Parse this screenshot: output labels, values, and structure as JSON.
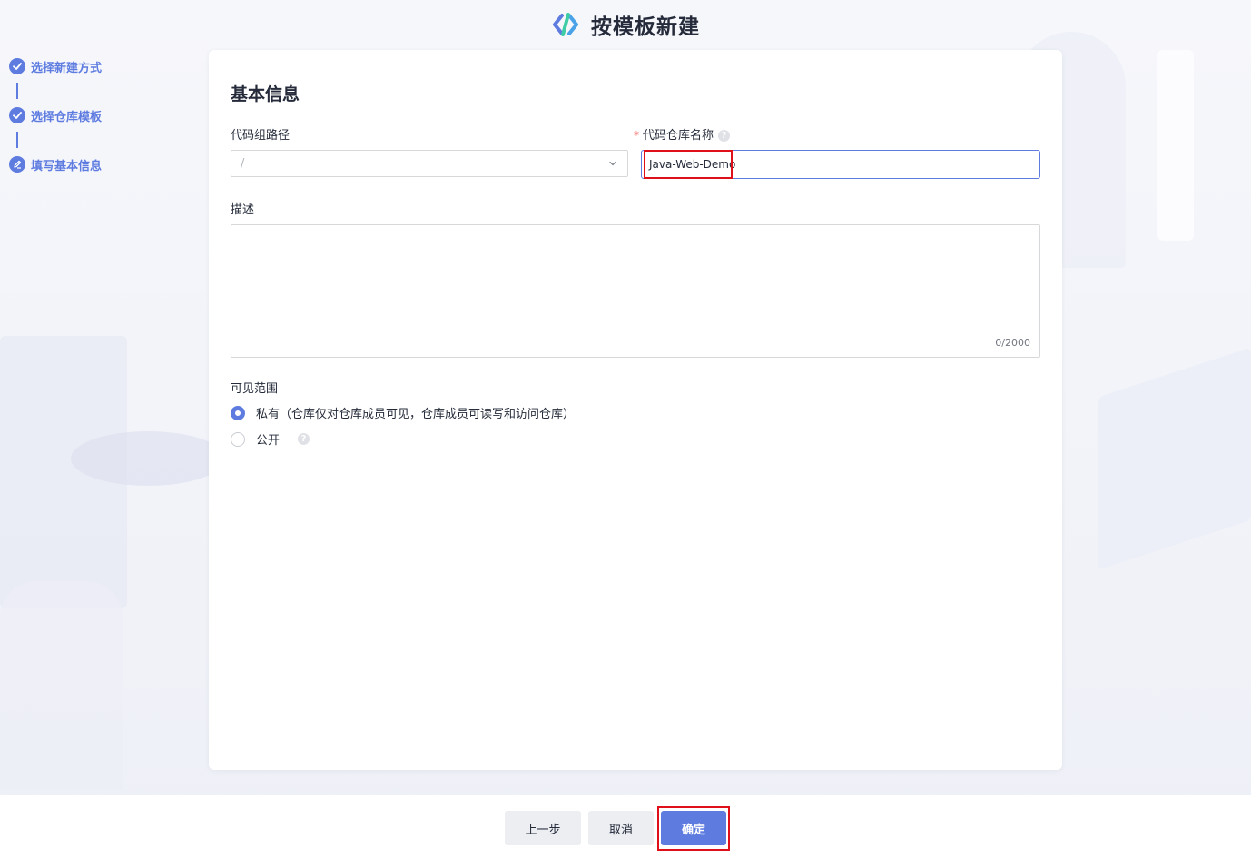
{
  "header": {
    "title": "按模板新建"
  },
  "steps": [
    {
      "label": "选择新建方式",
      "icon": "check-circle-icon",
      "status": "done"
    },
    {
      "label": "选择仓库模板",
      "icon": "check-circle-icon",
      "status": "done"
    },
    {
      "label": "填写基本信息",
      "icon": "edit-circle-icon",
      "status": "current"
    }
  ],
  "form": {
    "section_title": "基本信息",
    "group_path": {
      "label": "代码组路径",
      "value": "/"
    },
    "repo_name": {
      "required_mark": "*",
      "label": "代码仓库名称",
      "help": "?",
      "value": "Java-Web-Demo"
    },
    "description": {
      "label": "描述",
      "value": "",
      "counter": "0/2000"
    },
    "visibility": {
      "label": "可见范围",
      "options": [
        {
          "label": "私有（仓库仅对仓库成员可见，仓库成员可读写和访问仓库）",
          "checked": true
        },
        {
          "label": "公开",
          "checked": false,
          "help": "?"
        }
      ]
    }
  },
  "footer": {
    "prev_label": "上一步",
    "cancel_label": "取消",
    "confirm_label": "确定"
  },
  "colors": {
    "accent": "#5e7ce0",
    "highlight": "#e0101b",
    "required": "#f66f6a"
  }
}
